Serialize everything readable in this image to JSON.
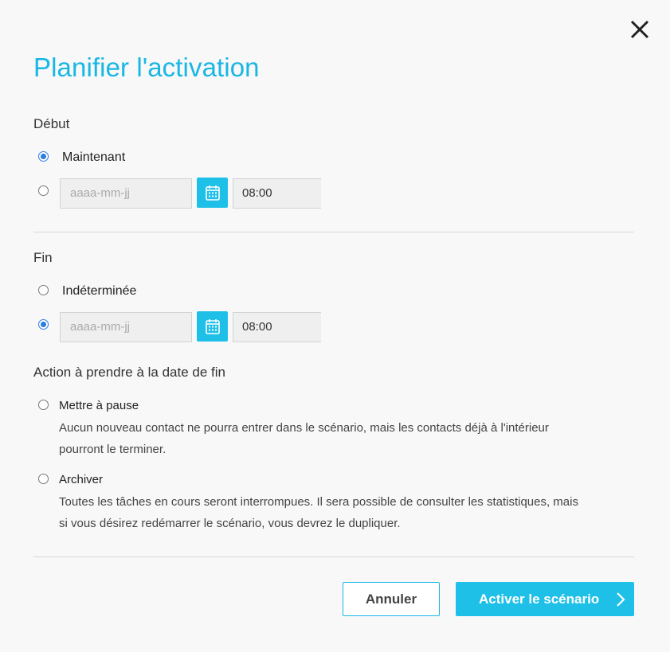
{
  "dialog": {
    "title": "Planifier l'activation",
    "close_icon": "close-icon"
  },
  "start": {
    "label": "Début",
    "now_label": "Maintenant",
    "now_checked": true,
    "date_placeholder": "aaaa-mm-jj",
    "date_value": "",
    "calendar_icon": "calendar-icon",
    "time_value": "08:00"
  },
  "end": {
    "label": "Fin",
    "indefinite_label": "Indéterminée",
    "indefinite_checked": false,
    "date_placeholder": "aaaa-mm-jj",
    "date_value": "",
    "calendar_icon": "calendar-icon",
    "time_value": "08:00"
  },
  "end_action": {
    "label": "Action à prendre à la date de fin",
    "options": [
      {
        "label": "Mettre à pause",
        "description_line1": "Aucun nouveau contact ne pourra entrer dans le scénario, mais les contacts déjà à l'intérieur",
        "description_line2": "pourront le terminer."
      },
      {
        "label": "Archiver",
        "description_line1": "Toutes les tâches en cours seront interrompues. Il sera possible de consulter les statistiques, mais",
        "description_line2": "si vous désirez redémarrer le scénario, vous devrez le dupliquer."
      }
    ]
  },
  "footer": {
    "cancel_label": "Annuler",
    "activate_label": "Activer le scénario",
    "activate_icon": "chevron-right-icon"
  },
  "colors": {
    "accent": "#19b7e3",
    "button_fill": "#1ec0e8",
    "radio_checked": "#2b7de0"
  }
}
